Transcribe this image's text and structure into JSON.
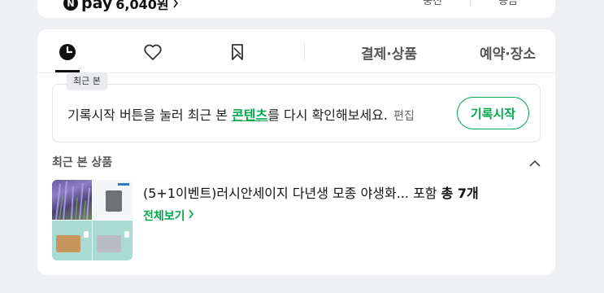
{
  "top": {
    "npay_logo": "N",
    "npay_label": "pay",
    "npay_amount": "6,040원",
    "right_links": [
      "충전",
      "송금"
    ]
  },
  "tabs": {
    "icons": [
      "recent-clock-icon",
      "heart-icon",
      "bookmark-icon"
    ],
    "text_tabs": [
      "결제·상품",
      "예약·장소"
    ],
    "tooltip": "최근 본"
  },
  "notice": {
    "prefix": "기록시작 버튼을 눌러 최근 본 ",
    "highlight": "콘텐츠",
    "suffix": "를 다시 확인해보세요.",
    "edit_label": "편집",
    "record_button": "기록시작"
  },
  "recent": {
    "section_title": "최근 본 상품",
    "product_title": "(5+1이벤트)러시안세이지 다년생 모종 야생화... 포함 ",
    "count_label": "총 7개",
    "view_all": "전체보기"
  },
  "colors": {
    "accent": "#03a94d",
    "background": "#eef0f3"
  }
}
